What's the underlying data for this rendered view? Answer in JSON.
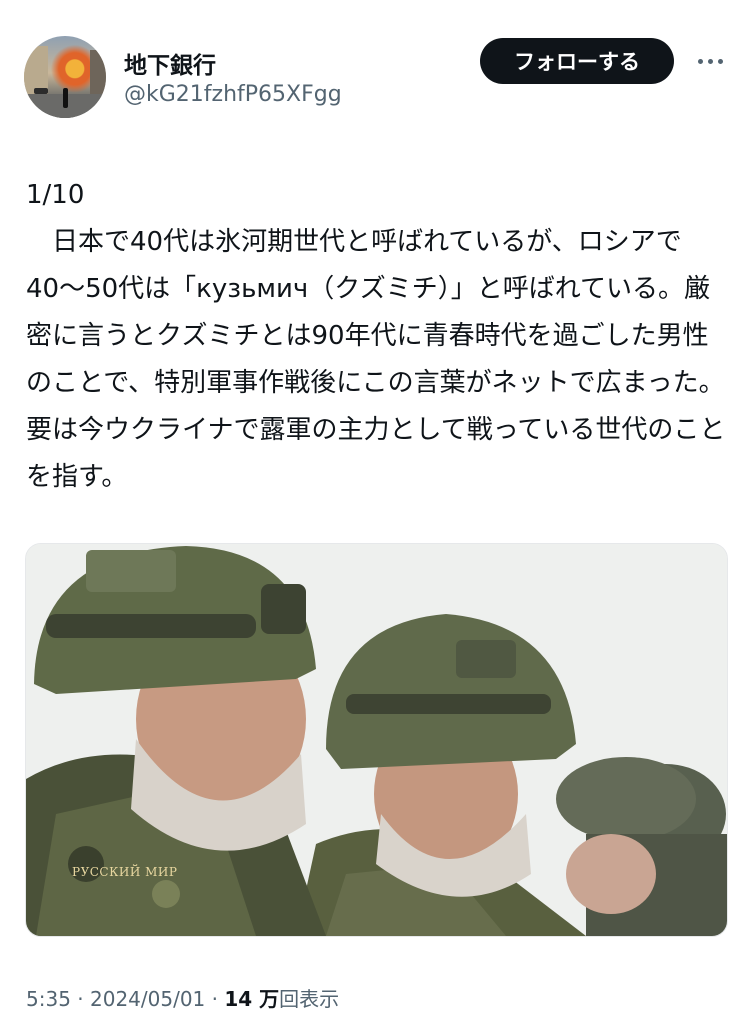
{
  "author": {
    "name": "地下銀行",
    "handle": "@kG21fzhfP65XFgg"
  },
  "header": {
    "follow_label": "フォローする",
    "more_icon": "more-horizontal-icon"
  },
  "tweet": {
    "text": "1/10\n　日本で40代は氷河期世代と呼ばれているが、ロシアで40〜50代は「кузьмич（クズミチ）」と呼ばれている。厳密に言うとクズミチとは90年代に青春時代を過ごした男性のことで、特別軍事作戦後にこの言葉がネットで広まった。要は今ウクライナで露軍の主力として戦っている世代のことを指す。",
    "image_watermark": "РУССКИЙ МИР"
  },
  "meta": {
    "time": "5:35",
    "separator": " · ",
    "date": "2024/05/01",
    "views_count": "14 万",
    "views_label": "回表示"
  }
}
